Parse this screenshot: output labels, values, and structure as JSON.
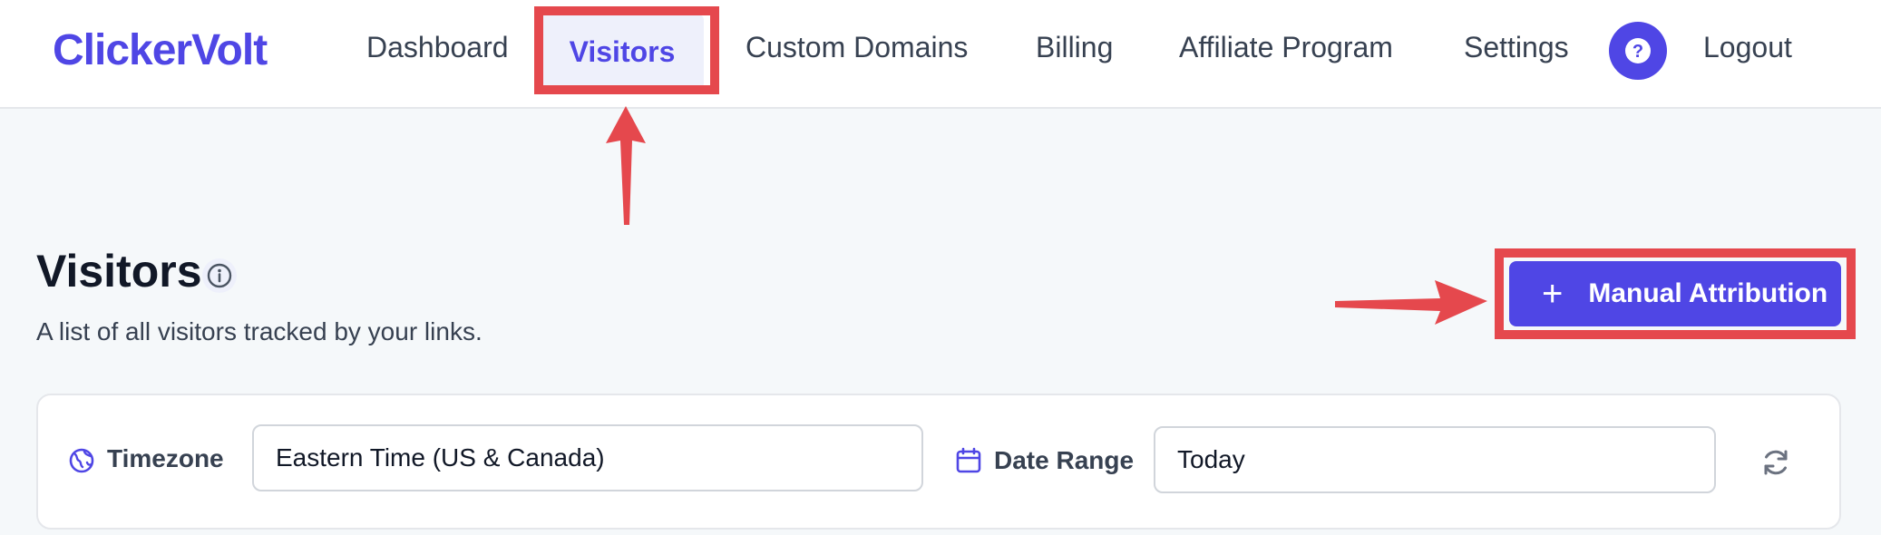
{
  "brand": {
    "name": "ClickerVolt",
    "accent": "#4f46e5"
  },
  "nav": {
    "dashboard": "Dashboard",
    "visitors": "Visitors",
    "custom_domains": "Custom Domains",
    "billing": "Billing",
    "affiliate_program": "Affiliate Program",
    "settings": "Settings",
    "help_icon": "question-icon",
    "logout": "Logout"
  },
  "page": {
    "title": "Visitors",
    "subtitle": "A list of all visitors tracked by your links.",
    "primary_action": {
      "label": "Manual Attribution",
      "icon": "plus-icon"
    }
  },
  "filters": {
    "timezone": {
      "label": "Timezone",
      "icon": "globe-icon",
      "value": "Eastern Time (US & Canada)"
    },
    "date_range": {
      "label": "Date Range",
      "icon": "calendar-icon",
      "value": "Today"
    },
    "refresh_icon": "refresh-icon"
  },
  "annotations": {
    "color": "#e5484d"
  }
}
